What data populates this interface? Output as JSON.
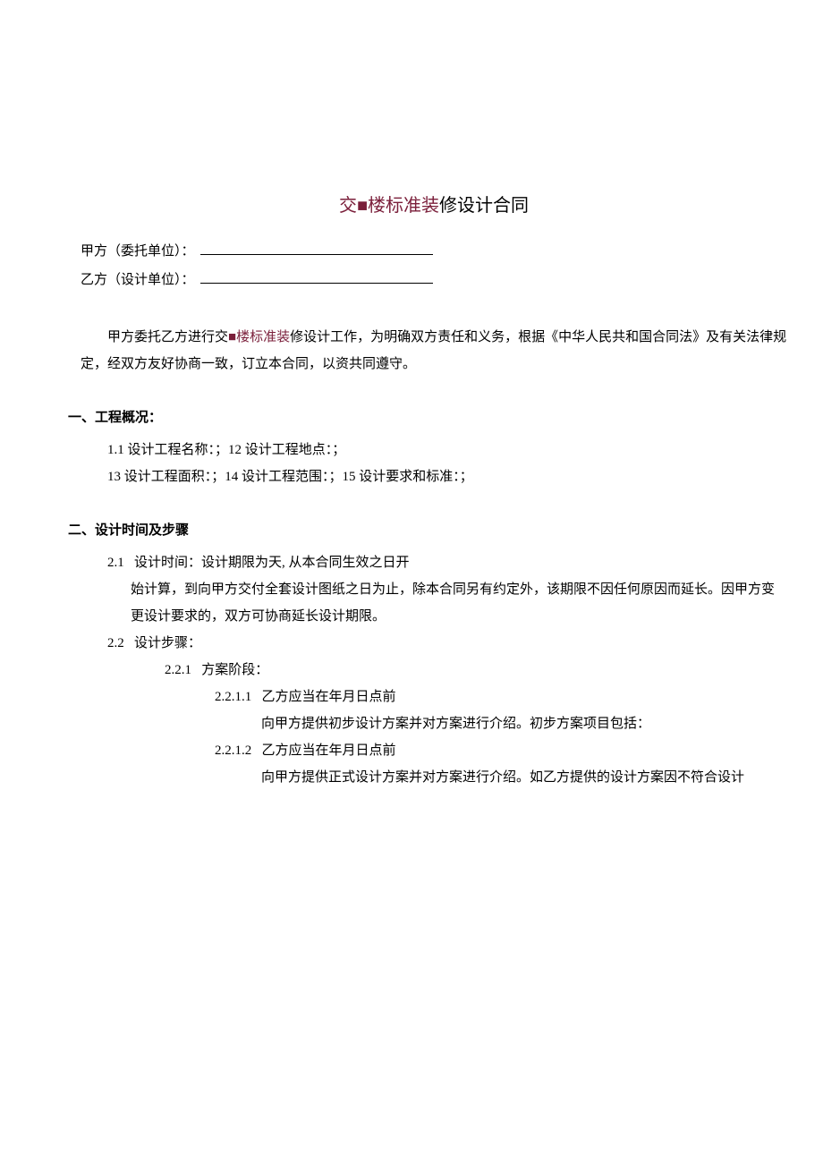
{
  "title": {
    "part1": "交",
    "redact": "■",
    "part2": "楼标准装",
    "part3": "修设计合同"
  },
  "parties": {
    "a_label": "甲方（委托单位）：",
    "b_label": "乙方（设计单位）："
  },
  "intro": {
    "pre": "甲方委托乙方进行交",
    "redact": "■",
    "mid": "楼标准装",
    "post": "修设计工作，为明确双方责任和义务，根据《中华人民共和国合同法》及有关法律规定，经双方友好协商一致，订立本合同，以资共同遵守。"
  },
  "section1": {
    "heading": "一、工程概况：",
    "line1": "1.1 设计工程名称：；12 设计工程地点：；",
    "line2": "13 设计工程面积：；14 设计工程范围：；15 设计要求和标准：；"
  },
  "section2": {
    "heading": "二、设计时间及步骤",
    "item21_label": "2.1",
    "item21_text1": "设计时间：设计期限为天, 从本合同生效之日开",
    "item21_text2": "始计算，到向甲方交付全套设计图纸之日为止，除本合同另有约定外，该期限不因任何原因而延长。因甲方变更设计要求的，双方可协商延长设计期限。",
    "item22_label": "2.2",
    "item22_text": "设计步骤：",
    "item221_label": "2.2.1",
    "item221_text": "方案阶段：",
    "item2211_label": "2.2.1.1",
    "item2211_text1": "乙方应当在年月日点前",
    "item2211_text2": "向甲方提供初步设计方案并对方案进行介绍。初步方案项目包括：",
    "item2212_label": "2.2.1.2",
    "item2212_text1": "乙方应当在年月日点前",
    "item2212_text2": "向甲方提供正式设计方案并对方案进行介绍。如乙方提供的设计方案因不符合设计"
  }
}
